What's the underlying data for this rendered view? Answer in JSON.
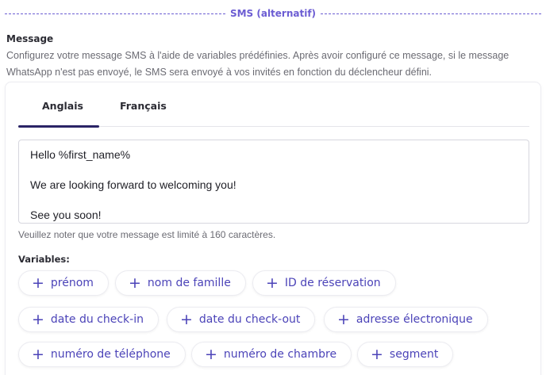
{
  "divider": {
    "label": "SMS (alternatif)"
  },
  "section": {
    "title": "Message",
    "description": "Configurez votre message SMS à l'aide de variables prédéfinies. Après avoir configuré ce message, si le message WhatsApp n'est pas envoyé, le SMS sera envoyé à vos invités en fonction du déclencheur défini."
  },
  "tabs": [
    {
      "label": "Anglais",
      "active": true
    },
    {
      "label": "Français",
      "active": false
    }
  ],
  "message": {
    "lines": [
      "Hello %first_name%",
      "We are looking forward to welcoming you!",
      "See you soon!"
    ]
  },
  "hint": "Veuillez noter que votre message est limité à 160 caractères.",
  "variables": {
    "title": "Variables:",
    "items": [
      {
        "label": "prénom"
      },
      {
        "label": "nom de famille"
      },
      {
        "label": "ID de réservation"
      },
      {
        "label": "date du check-in"
      },
      {
        "label": "date du check-out"
      },
      {
        "label": "adresse électronique"
      },
      {
        "label": "numéro de téléphone"
      },
      {
        "label": "numéro de chambre"
      },
      {
        "label": "segment"
      }
    ],
    "plus_glyph": "+"
  },
  "colors": {
    "accent": "#4b43b8",
    "tab_indicator": "#2a2466",
    "divider": "#6c5dd3"
  }
}
